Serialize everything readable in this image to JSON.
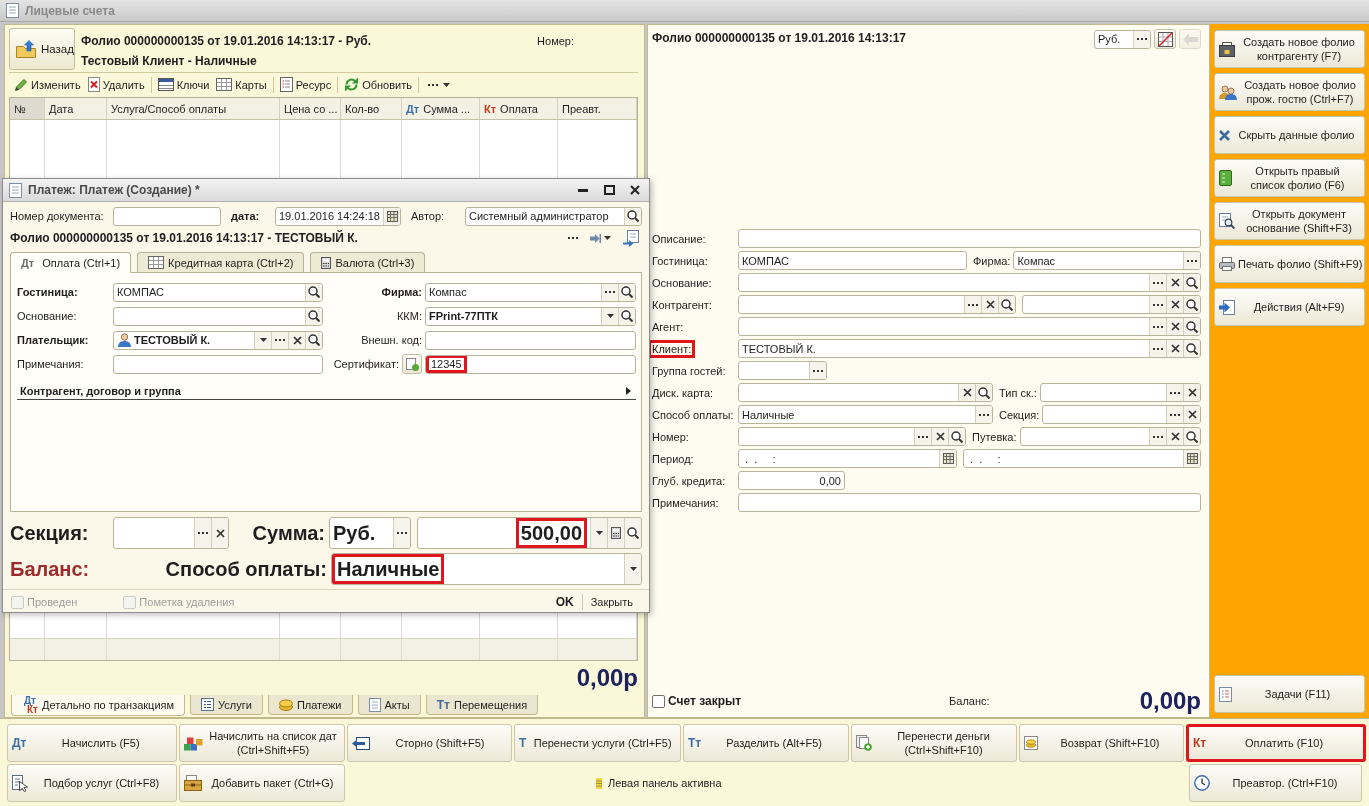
{
  "window": {
    "title": "Лицевые счета"
  },
  "left_panel": {
    "back_button": {
      "label": "Назад"
    },
    "title_lines": [
      "Фолио 000000000135 от 19.01.2016 14:13:17 - Руб.",
      "Тестовый Клиент - Наличные"
    ],
    "number_label": "Номер:",
    "toolbar": {
      "groups": [
        {
          "items": [
            {
              "kind": "button",
              "label": "Изменить"
            },
            {
              "kind": "button",
              "label": "Удалить"
            }
          ]
        },
        {
          "items": [
            {
              "kind": "button",
              "label": "Ключи"
            },
            {
              "kind": "button",
              "label": "Карты"
            }
          ]
        },
        {
          "items": [
            {
              "kind": "button",
              "label": "Ресурс"
            }
          ]
        },
        {
          "items": [
            {
              "kind": "button",
              "label": "Обновить"
            }
          ]
        },
        {
          "items": [
            {
              "kind": "menu"
            }
          ]
        }
      ]
    },
    "table": {
      "columns": [
        {
          "label": "№"
        },
        {
          "label": "Дата"
        },
        {
          "label": "Услуга/Способ оплаты"
        },
        {
          "label": "Цена со ..."
        },
        {
          "label": "Кол-во"
        },
        {
          "prefix": {
            "text": "Дт",
            "color": "#3d6fa8"
          },
          "label": "Сумма ..."
        },
        {
          "prefix": {
            "text": "Кт",
            "color": "#c23a22"
          },
          "label": "Оплата"
        },
        {
          "label": "Преавт."
        }
      ]
    },
    "total": "0,00р",
    "tabs": [
      {
        "glyphs": [
          {
            "text": "Дт",
            "color": "#3d6fa8"
          },
          {
            "text": "Кт",
            "color": "#c23a22"
          }
        ],
        "label": "Детально по транзакциям",
        "selected": true
      },
      {
        "label": "Услуги",
        "selected": false
      },
      {
        "label": "Платежи",
        "selected": false
      },
      {
        "label": "Акты",
        "selected": false
      },
      {
        "glyphs": [
          {
            "text": "Тт",
            "color": "#4a6a9a"
          }
        ],
        "label": "Перемещения",
        "selected": false
      }
    ]
  },
  "folio_panel": {
    "title": "Фолио 000000000135 от 19.01.2016 14:13:17",
    "currency": {
      "value": "Руб.",
      "buttons": [
        {
          "kind": "choose"
        }
      ]
    },
    "tool_buttons": [
      {
        "disabled": false
      },
      {
        "disabled": true
      }
    ],
    "rows": [
      {
        "label": "Описание:",
        "highlighted": false,
        "fields": [
          {
            "kind": "text"
          }
        ]
      },
      {
        "label": "Гостиница:",
        "highlighted": false,
        "fields": [
          {
            "kind": "text",
            "value": "КОМПАС"
          },
          {
            "kind": "text",
            "label": "Фирма:",
            "value": "Компас",
            "buttons": [
              {
                "kind": "choose"
              }
            ]
          }
        ]
      },
      {
        "label": "Основание:",
        "highlighted": false,
        "fields": [
          {
            "kind": "text",
            "buttons": [
              {
                "kind": "choose"
              },
              {
                "kind": "clear"
              },
              {
                "kind": "search"
              }
            ]
          }
        ]
      },
      {
        "label": "Контрагент:",
        "highlighted": false,
        "fields": [
          {
            "kind": "text",
            "buttons": [
              {
                "kind": "choose"
              },
              {
                "kind": "clear"
              },
              {
                "kind": "search"
              }
            ]
          },
          {
            "kind": "text",
            "buttons": [
              {
                "kind": "choose"
              },
              {
                "kind": "clear"
              },
              {
                "kind": "search"
              }
            ]
          }
        ]
      },
      {
        "label": "Агент:",
        "highlighted": false,
        "fields": [
          {
            "kind": "text",
            "buttons": [
              {
                "kind": "choose"
              },
              {
                "kind": "clear"
              },
              {
                "kind": "search"
              }
            ]
          }
        ]
      },
      {
        "label": "Клиент:",
        "highlighted": true,
        "fields": [
          {
            "kind": "text",
            "value": "ТЕСТОВЫЙ К.",
            "buttons": [
              {
                "kind": "choose"
              },
              {
                "kind": "clear"
              },
              {
                "kind": "search"
              }
            ]
          }
        ]
      },
      {
        "label": "Группа гостей:",
        "highlighted": false,
        "fields": [
          {
            "kind": "text",
            "buttons": [
              {
                "kind": "choose"
              }
            ]
          }
        ]
      },
      {
        "label": "Диск. карта:",
        "highlighted": false,
        "fields": [
          {
            "kind": "text",
            "buttons": [
              {
                "kind": "clear"
              },
              {
                "kind": "search"
              }
            ]
          },
          {
            "kind": "text",
            "label": "Тип ск.:",
            "buttons": [
              {
                "kind": "choose"
              },
              {
                "kind": "clear"
              }
            ]
          }
        ]
      },
      {
        "label": "Способ оплаты:",
        "highlighted": false,
        "fields": [
          {
            "kind": "text",
            "value": "Наличные",
            "buttons": [
              {
                "kind": "choose"
              }
            ]
          },
          {
            "kind": "text",
            "label": "Секция:",
            "buttons": [
              {
                "kind": "choose"
              },
              {
                "kind": "clear"
              }
            ]
          }
        ]
      },
      {
        "label": "Номер:",
        "highlighted": false,
        "fields": [
          {
            "kind": "text",
            "buttons": [
              {
                "kind": "choose"
              },
              {
                "kind": "clear"
              },
              {
                "kind": "search"
              }
            ]
          },
          {
            "kind": "text",
            "label": "Путевка:",
            "buttons": [
              {
                "kind": "choose"
              },
              {
                "kind": "clear"
              },
              {
                "kind": "search"
              }
            ]
          }
        ]
      },
      {
        "label": "Период:",
        "highlighted": false,
        "fields": [
          {
            "kind": "date",
            "value": " .  .     :",
            "buttons": [
              {
                "kind": "calendar"
              }
            ]
          },
          {
            "kind": "date",
            "value": " .  .     :",
            "buttons": [
              {
                "kind": "calendar"
              }
            ]
          }
        ]
      },
      {
        "label": "Глуб. кредита:",
        "highlighted": false,
        "fields": [
          {
            "kind": "number",
            "value": "0,00"
          }
        ]
      },
      {
        "label": "Примечания:",
        "highlighted": false,
        "fields": [
          {
            "kind": "text"
          }
        ]
      }
    ],
    "closed_checkbox": {
      "label": "Счет закрыт",
      "checked": false
    },
    "balance_label": "Баланс:",
    "balance": "0,00р"
  },
  "sidebar": {
    "actions": [
      {
        "label": "Создать новое фолио\nконтрагенту (F7)"
      },
      {
        "label": "Создать новое фолио\nпрож. гостю (Ctrl+F7)"
      },
      {
        "label": "Скрыть данные фолио"
      },
      {
        "label": "Открыть правый\nсписок фолио (F6)"
      },
      {
        "label": "Открыть документ\nоснование (Shift+F3)"
      },
      {
        "label": "Печать фолио (Shift+F9)"
      },
      {
        "label": "Действия (Alt+F9)"
      }
    ],
    "tasks_button": {
      "label": "Задачи (F11)"
    }
  },
  "bottom_bar": {
    "row_1": [
      {
        "glyphs": [
          {
            "text": "Дт",
            "color": "#3d6fa8"
          }
        ],
        "label": "Начислить (F5)",
        "highlighted": false
      },
      {
        "label": "Начислить на список дат\n(Ctrl+Shift+F5)",
        "highlighted": false
      },
      {
        "label": "Сторно (Shift+F5)",
        "highlighted": false
      },
      {
        "glyphs": [
          {
            "text": "Т",
            "color": "#3d6fa8"
          }
        ],
        "label": "Перенести услуги (Ctrl+F5)",
        "highlighted": false
      },
      {
        "glyphs": [
          {
            "text": "Тт",
            "color": "#3d6fa8"
          }
        ],
        "label": "Разделить (Alt+F5)",
        "highlighted": false
      },
      {
        "label": "Перенести деньги\n(Ctrl+Shift+F10)",
        "highlighted": false
      },
      {
        "label": "Возврат (Shift+F10)",
        "highlighted": false
      },
      {
        "glyphs": [
          {
            "text": "Кт",
            "color": "#c23a22"
          }
        ],
        "label": "Оплатить (F10)",
        "highlighted": true
      }
    ],
    "row_2": [
      {
        "label": "Подбор услуг (Ctrl+F8)"
      },
      {
        "label": "Добавить пакет (Ctrl+G)"
      },
      {
        "label": "Преавтор. (Ctrl+F10)"
      }
    ],
    "status": "Левая панель активна"
  },
  "payment_dialog": {
    "title": "Платеж: Платеж (Создание) *",
    "doc_number": {
      "label": "Номер документа:",
      "required": false
    },
    "date": {
      "label": "дата:",
      "required": true,
      "value": "19.01.2016 14:24:18",
      "buttons": [
        {
          "kind": "calendar"
        }
      ]
    },
    "author": {
      "label": "Автор:",
      "required": false,
      "value": "Системный администратор",
      "buttons": [
        {
          "kind": "search"
        }
      ]
    },
    "folio": "Фолио 000000000135 от 19.01.2016 14:13:17 - ТЕСТОВЫЙ К.",
    "tabs": [
      {
        "prefix": {
          "text": "Дт",
          "color": "#6e6e6e"
        },
        "label": "Оплата (Ctrl+1)",
        "selected": true
      },
      {
        "label": "Кредитная карта (Ctrl+2)",
        "selected": false
      },
      {
        "label": "Валюта (Ctrl+3)",
        "selected": false
      }
    ],
    "form_rows": [
      {
        "left": {
          "kind": "text",
          "label": "Гостиница:",
          "required": true,
          "value": "КОМПАС",
          "buttons": [
            {
              "kind": "search"
            }
          ]
        },
        "right": {
          "kind": "text",
          "label": "Фирма:",
          "required": true,
          "value": "Компас",
          "buttons": [
            {
              "kind": "choose"
            },
            {
              "kind": "search"
            }
          ]
        }
      },
      {
        "left": {
          "kind": "text",
          "label": "Основание:",
          "required": false,
          "buttons": [
            {
              "kind": "search"
            }
          ]
        },
        "right": {
          "kind": "text",
          "label": "ККМ:",
          "required": false,
          "value": "FPrint-77ПТК",
          "emphasized": true,
          "buttons": [
            {
              "kind": "dropdown"
            },
            {
              "kind": "search"
            }
          ]
        }
      },
      {
        "left": {
          "kind": "person",
          "label": "Плательщик:",
          "required": true,
          "value": "ТЕСТОВЫЙ К.",
          "emphasized": true,
          "buttons": [
            {
              "kind": "dropdown"
            },
            {
              "kind": "choose"
            },
            {
              "kind": "clear"
            },
            {
              "kind": "search"
            }
          ]
        },
        "right": {
          "kind": "text",
          "label": "Внешн. код:",
          "required": false
        }
      },
      {
        "left": {
          "kind": "text",
          "label": "Примечания:",
          "required": false
        },
        "right": {
          "kind": "certificate",
          "label": "Сертификат:",
          "required": false,
          "value": "12345",
          "highlighted": true
        }
      }
    ],
    "group": {
      "label": "Контрагент, договор и группа",
      "expanded": false
    },
    "section": {
      "label": "Секция:",
      "buttons": [
        {
          "kind": "choose"
        },
        {
          "kind": "clear"
        }
      ]
    },
    "sum": {
      "label": "Сумма:",
      "currency": {
        "value": "Руб.",
        "buttons": [
          {
            "kind": "choose"
          }
        ]
      },
      "amount": {
        "value": "500,00",
        "highlighted": true,
        "buttons": [
          {
            "kind": "dropdown"
          },
          {
            "kind": "calc"
          },
          {
            "kind": "search"
          }
        ]
      }
    },
    "balance_label": "Баланс:",
    "payment_method": {
      "label": "Способ оплаты:",
      "field": {
        "value": "Наличные",
        "highlighted": true,
        "buttons": [
          {
            "kind": "dropdown"
          }
        ]
      }
    },
    "footer": {
      "checkboxes": [
        {
          "label": "Проведен",
          "checked": false,
          "disabled": true
        },
        {
          "label": "Пометка удаления",
          "checked": false,
          "disabled": true
        }
      ],
      "buttons": [
        {
          "label": "OK",
          "default": true
        },
        {
          "label": "Закрыть",
          "default": false
        }
      ]
    }
  }
}
